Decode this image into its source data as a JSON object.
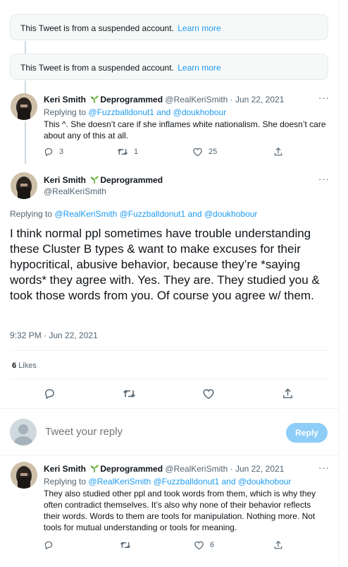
{
  "suspended": [
    {
      "text": "This Tweet is from a suspended account.",
      "link": "Learn more"
    },
    {
      "text": "This Tweet is from a suspended account.",
      "link": "Learn more"
    }
  ],
  "tweet1": {
    "name": "Keri Smith",
    "suffix": "Deprogrammed",
    "handle": "@RealKeriSmith",
    "sep": "·",
    "date": "Jun 22, 2021",
    "replying_prefix": "Replying to",
    "replying_users": "@Fuzzballdonut1 and @doukhobour",
    "text": "This ^. She doesn’t care if she inflames white nationalism. She doesn’t care about any of this at all.",
    "replies": "3",
    "retweets": "1",
    "likes": "25"
  },
  "main_tweet": {
    "name": "Keri Smith",
    "suffix": "Deprogrammed",
    "handle": "@RealKeriSmith",
    "replying_prefix": "Replying to",
    "replying_users": "@RealKeriSmith @Fuzzballdonut1 and @doukhobour",
    "text": "I think normal ppl sometimes have trouble understanding these Cluster B types & want to make excuses for their hypocritical, abusive behavior, because they’re *saying words* they agree with. Yes. They are. They studied you & took those words from you. Of course you agree w/ them.",
    "timestamp": "9:32 PM · Jun 22, 2021",
    "like_count": "6",
    "like_label": "Likes"
  },
  "compose": {
    "placeholder": "Tweet your reply",
    "button": "Reply"
  },
  "tweet3": {
    "name": "Keri Smith",
    "suffix": "Deprogrammed",
    "handle": "@RealKeriSmith",
    "sep": "·",
    "date": "Jun 22, 2021",
    "replying_prefix": "Replying to",
    "replying_users": "@RealKeriSmith @Fuzzballdonut1 and @doukhobour",
    "text": "They also studied other ppl and took words from them, which is why they often contradict themselves. It’s also why none of their behavior reflects their words. Words to them are tools for manipulation. Nothing more. Not tools for mutual understanding or tools for meaning.",
    "likes": "6"
  },
  "colors": {
    "accent": "#1d9bf0",
    "muted": "#536471",
    "sprout": "#5fa53a",
    "reply_button": "#8ecdf8"
  },
  "icons": [
    "reply-icon",
    "retweet-icon",
    "like-icon",
    "share-icon",
    "more-icon",
    "sprout-icon",
    "default-avatar-icon"
  ]
}
